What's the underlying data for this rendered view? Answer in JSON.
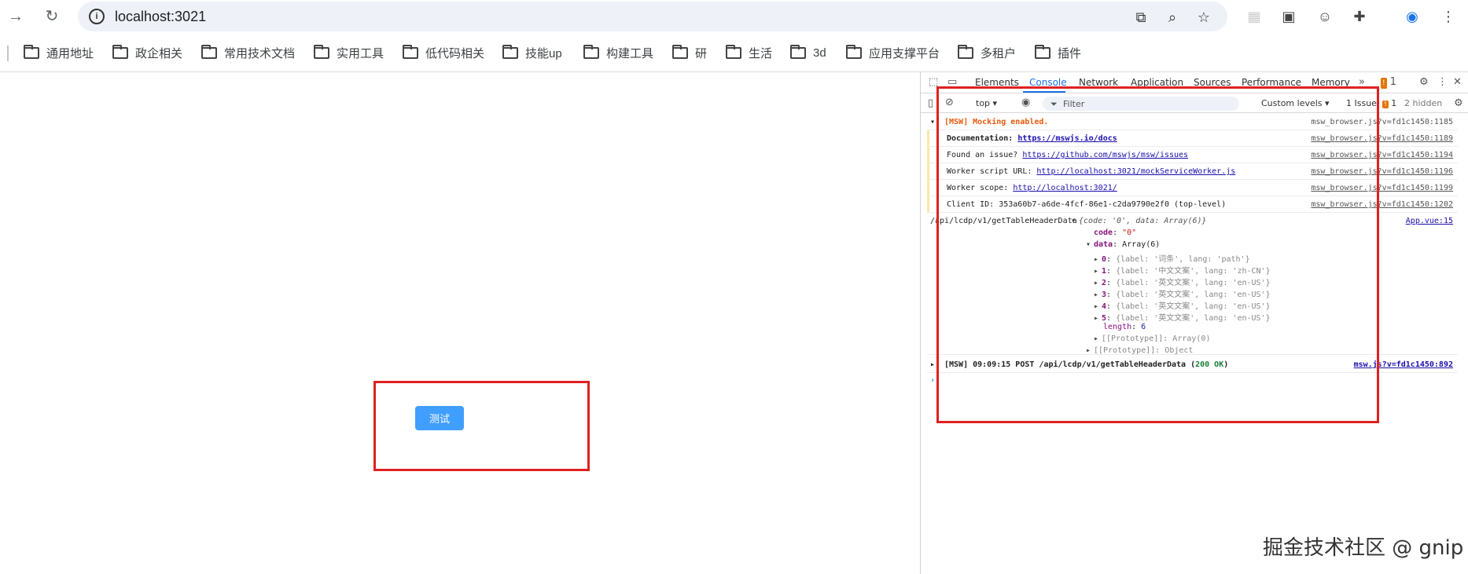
{
  "browser": {
    "url": "localhost:3021",
    "bookmarks": [
      "通用地址",
      "政企相关",
      "常用技术文档",
      "实用工具",
      "低代码相关",
      "技能up",
      "构建工具",
      "研",
      "生活",
      "3d",
      "应用支撑平台",
      "多租户",
      "插件"
    ]
  },
  "page": {
    "button_label": "测试",
    "accent": "#409eff",
    "highlight": "#e02020"
  },
  "devtools": {
    "tabs": [
      "Elements",
      "Console",
      "Network",
      "Application",
      "Sources",
      "Performance",
      "Memory"
    ],
    "active_tab": "Console",
    "issues_count": "1",
    "context": "top",
    "filter_placeholder": "Filter",
    "levels": "Custom levels",
    "issues_text": "1 Issue:",
    "issues_num": "1",
    "hidden": "2 hidden",
    "logs": {
      "msw_enabled": "[MSW] Mocking enabled.",
      "msw_enabled_src": "msw_browser.js?v=fd1c1450:1185",
      "doc_label": "Documentation:",
      "doc_link": "https://mswjs.io/docs",
      "doc_src": "msw_browser.js?v=fd1c1450:1189",
      "issue_label": "Found an issue?",
      "issue_link": "https://github.com/mswjs/msw/issues",
      "issue_src": "msw_browser.js?v=fd1c1450:1194",
      "worker_url_label": "Worker script URL:",
      "worker_url_link": "http://localhost:3021/mockServiceWorker.js",
      "worker_url_src": "msw_browser.js?v=fd1c1450:1196",
      "scope_label": "Worker scope:",
      "scope_link": "http://localhost:3021/",
      "scope_src": "msw_browser.js?v=fd1c1450:1199",
      "client_id": "Client ID: 353a60b7-a6de-4fcf-86e1-c2da9790e2f0 (top-level)",
      "client_src": "msw_browser.js?v=fd1c1450:1202",
      "api_path": "/api/lcdp/v1/getTableHeaderData",
      "obj_preview": "{code: '0', data: Array(6)}",
      "app_src": "App.vue:15",
      "code_key": "code",
      "code_val": "\"0\"",
      "data_key": "data",
      "data_val": "Array(6)",
      "items": [
        {
          "idx": "0",
          "text": "{label: '词条', lang: 'path'}"
        },
        {
          "idx": "1",
          "text": "{label: '中文文案', lang: 'zh-CN'}"
        },
        {
          "idx": "2",
          "text": "{label: '英文文案', lang: 'en-US'}"
        },
        {
          "idx": "3",
          "text": "{label: '英文文案', lang: 'en-US'}"
        },
        {
          "idx": "4",
          "text": "{label: '英文文案', lang: 'en-US'}"
        },
        {
          "idx": "5",
          "text": "{label: '英文文案', lang: 'en-US'}"
        }
      ],
      "length_key": "length",
      "length_val": "6",
      "proto_array": "[[Prototype]]: Array(0)",
      "proto_object": "[[Prototype]]: Object",
      "post_line_a": "[MSW] 09:09:15 POST /api/lcdp/v1/getTableHeaderData (",
      "post_status": "200 OK",
      "post_line_b": ")",
      "post_src": "msw.js?v=fd1c1450:892"
    }
  },
  "watermark": "掘金技术社区 @ gnip"
}
